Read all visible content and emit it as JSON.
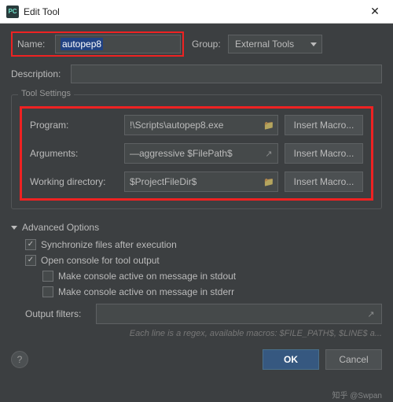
{
  "window": {
    "title": "Edit Tool",
    "app_icon": "PC"
  },
  "form": {
    "name_label": "Name:",
    "name_value": "autopep8",
    "group_label": "Group:",
    "group_value": "External Tools",
    "description_label": "Description:",
    "description_value": ""
  },
  "tool_settings": {
    "legend": "Tool Settings",
    "program_label": "Program:",
    "program_value": "!\\Scripts\\autopep8.exe",
    "arguments_label": "Arguments:",
    "arguments_value": "—aggressive $FilePath$",
    "workdir_label": "Working directory:",
    "workdir_value": "$ProjectFileDir$",
    "insert_macro_btn": "Insert Macro..."
  },
  "advanced": {
    "header": "Advanced Options",
    "sync_label": "Synchronize files after execution",
    "sync_checked": true,
    "console_label": "Open console for tool output",
    "console_checked": true,
    "stdout_label": "Make console active on message in stdout",
    "stdout_checked": false,
    "stderr_label": "Make console active on message in stderr",
    "stderr_checked": false,
    "filters_label": "Output filters:",
    "filters_value": "",
    "hint": "Each line is a regex, available macros: $FILE_PATH$, $LINE$ a..."
  },
  "buttons": {
    "ok": "OK",
    "cancel": "Cancel",
    "help": "?"
  },
  "watermark": "知乎 @Swpan"
}
